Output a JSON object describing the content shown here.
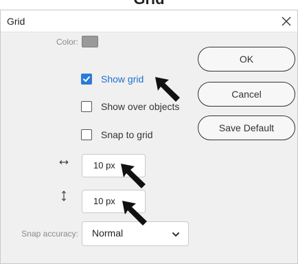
{
  "dialog": {
    "title": "Grid",
    "close_glyph": "×"
  },
  "fields": {
    "color_label": "Color:",
    "color_value": "#9a9a9a",
    "show_grid": {
      "label": "Show grid",
      "checked": true
    },
    "show_over_objects": {
      "label": "Show over objects",
      "checked": false
    },
    "snap_to_grid": {
      "label": "Snap to grid",
      "checked": false
    },
    "horizontal_spacing": {
      "value": "10 px",
      "icon": "horizontal-arrows-icon"
    },
    "vertical_spacing": {
      "value": "10 px",
      "icon": "vertical-arrows-icon"
    },
    "snap_accuracy_label": "Snap accuracy:",
    "snap_accuracy_value": "Normal"
  },
  "buttons": {
    "ok": "OK",
    "cancel": "Cancel",
    "save_default": "Save Default"
  },
  "colors": {
    "accent": "#2b7bd6",
    "label_grey": "#8a8a8a",
    "dialog_bg": "#f0f0f0"
  }
}
